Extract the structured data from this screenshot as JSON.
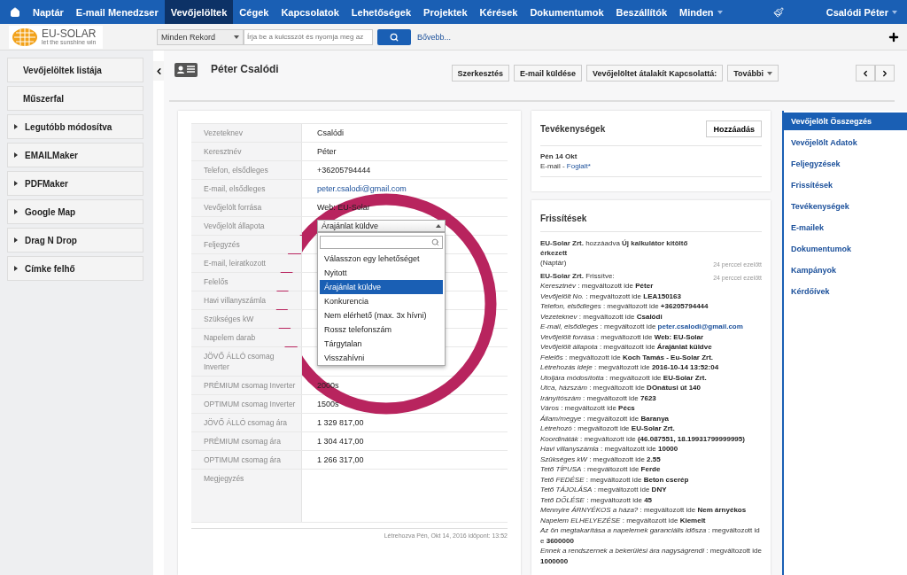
{
  "top_nav": {
    "items": [
      {
        "label": "Naptár",
        "selected": false
      },
      {
        "label": "E-mail Menedzser",
        "selected": false
      },
      {
        "label": "Vevőjelöltek",
        "selected": true
      },
      {
        "label": "Cégek",
        "selected": false
      },
      {
        "label": "Kapcsolatok",
        "selected": false
      },
      {
        "label": "Lehetőségek",
        "selected": false
      },
      {
        "label": "Projektek",
        "selected": false
      },
      {
        "label": "Kérések",
        "selected": false
      },
      {
        "label": "Dokumentumok",
        "selected": false
      },
      {
        "label": "Beszállítók",
        "selected": false
      },
      {
        "label": "Minden",
        "selected": false,
        "dropdown": true
      }
    ],
    "user": "Csalódi Péter"
  },
  "search_bar": {
    "logo": {
      "name": "EU-SOLAR",
      "tagline": "let the sunshine win"
    },
    "scope": "Minden Rekord",
    "placeholder": "Írja be a kulcsszót és nyomja meg az",
    "more_link": "Bővebb..."
  },
  "sidebar": {
    "items": [
      {
        "label": "Vevőjelöltek listája",
        "kind": "plain"
      },
      {
        "label": "Műszerfal",
        "kind": "plain"
      },
      {
        "label": "Legutóbb módosítva",
        "kind": "expandable"
      },
      {
        "label": "EMAILMaker",
        "kind": "expandable"
      },
      {
        "label": "PDFMaker",
        "kind": "expandable"
      },
      {
        "label": "Google Map",
        "kind": "expandable"
      },
      {
        "label": "Drag N Drop",
        "kind": "expandable"
      },
      {
        "label": "Címke felhő",
        "kind": "expandable"
      }
    ]
  },
  "record": {
    "title": "Péter Csalódi",
    "actions": [
      {
        "label": "Szerkesztés"
      },
      {
        "label": "E-mail küldése"
      },
      {
        "label": "Vevőjelöltet átalakít Kapcsolattá:"
      },
      {
        "label": "További",
        "dropdown": true
      }
    ]
  },
  "details": {
    "rows": [
      {
        "label": "Vezeteknev",
        "value": "Csalódi",
        "kind": "text"
      },
      {
        "label": "Keresztnév",
        "value": "Péter",
        "kind": "text"
      },
      {
        "label": "Telefon, elsődleges",
        "value": "+36205794444",
        "kind": "text"
      },
      {
        "label": "E-mail, elsődleges",
        "value": "peter.csalodi@gmail.com",
        "kind": "link"
      },
      {
        "label": "Vevőjelölt forrása",
        "value": "Web: EU-Solar",
        "kind": "text"
      },
      {
        "label": "Vevőjelölt állapota",
        "kind": "select"
      },
      {
        "label": "Feljegyzés",
        "kind": "text"
      },
      {
        "label": "E-mail, leiratkozott",
        "kind": "text"
      },
      {
        "label": "Felelős",
        "kind": "text"
      },
      {
        "label": "Havi villanyszámla",
        "kind": "text"
      },
      {
        "label": "Szükséges kW",
        "kind": "text"
      },
      {
        "label": "Napelem darab",
        "kind": "text"
      },
      {
        "label": "JÖVŐ ÁLLÓ csomag Inverter",
        "kind": "text"
      },
      {
        "label": "PRÉMIUM csomag Inverter",
        "value": "2000s",
        "kind": "text"
      },
      {
        "label": "OPTIMUM csomag Inverter",
        "value": "1500s",
        "kind": "text"
      },
      {
        "label": "JÖVŐ ÁLLÓ csomag ára",
        "value": "1 329 817,00",
        "kind": "text"
      },
      {
        "label": "PRÉMIUM csomag ára",
        "value": "1 304 417,00",
        "kind": "text"
      },
      {
        "label": "OPTIMUM csomag ára",
        "value": "1 266 317,00",
        "kind": "text"
      },
      {
        "label": "Megjegyzés",
        "kind": "note"
      }
    ],
    "status_select": {
      "value": "Árajánlat küldve",
      "options": [
        {
          "label": "Válasszon egy lehetőséget",
          "selected": false
        },
        {
          "label": "Nyitott",
          "selected": false
        },
        {
          "label": "Árajánlat küldve",
          "selected": true
        },
        {
          "label": "Konkurencia",
          "selected": false
        },
        {
          "label": "Nem elérhető (max. 3x hívni)",
          "selected": false
        },
        {
          "label": "Rossz telefonszám",
          "selected": false
        },
        {
          "label": "Tárgytalan",
          "selected": false
        },
        {
          "label": "Visszahívni",
          "selected": false
        }
      ]
    },
    "created": "Létrehozva Pén, Okt 14, 2016 időpont: 13:52"
  },
  "activities": {
    "title": "Tevékenységek",
    "add_button": "Hozzáadás",
    "items": [
      {
        "date": "Pén 14 Okt",
        "type": "E-mail -",
        "status": "Foglalt*"
      }
    ]
  },
  "updates": {
    "title": "Frissítések",
    "entries": [
      {
        "actor": "EU-Solar Zrt.",
        "action": "hozzáadva",
        "target": "Új kalkulátor kitöltő érkezett",
        "source": "(Naptár)",
        "time": "24 perccel ezelőtt"
      },
      {
        "actor": "EU-Solar Zrt.",
        "action": "Frissítve:",
        "time": "24 perccel ezelőtt",
        "changes": [
          {
            "field": "Keresztnév",
            "sep": ":",
            "verb": "megváltozott ide",
            "value": "Péter",
            "kind": "text"
          },
          {
            "field": "Vevőjelölt No.",
            "sep": ":",
            "verb": "megváltozott ide",
            "value": "LEA150163",
            "kind": "text"
          },
          {
            "field": "Telefon, elsődleges",
            "sep": ":",
            "verb": "megváltozott ide",
            "value": "+36205794444",
            "kind": "text"
          },
          {
            "field": "Vezeteknev",
            "sep": ":",
            "verb": "megváltozott ide",
            "value": "Csalódi",
            "kind": "text"
          },
          {
            "field": "E-mail, elsődleges",
            "sep": ":",
            "verb": "megváltozott ide",
            "value": "peter.csalodi@gmail.com",
            "kind": "link"
          },
          {
            "field": "Vevőjelölt forrása",
            "sep": ":",
            "verb": "megváltozott ide",
            "value": "Web: EU-Solar",
            "kind": "text"
          },
          {
            "field": "Vevőjelölt állapota",
            "sep": ":",
            "verb": "megváltozott ide",
            "value": "Árajánlat küldve",
            "kind": "text"
          },
          {
            "field": "Felelős",
            "sep": ":",
            "verb": "megváltozott ide",
            "value": "Koch Tamás - Eu-Solar Zrt.",
            "kind": "text"
          },
          {
            "field": "Létrehozás ideje",
            "sep": ":",
            "verb": "megváltozott ide",
            "value": "2016-10-14 13:52:04",
            "kind": "text"
          },
          {
            "field": "Utoljára módosította",
            "sep": ":",
            "verb": "megváltozott ide",
            "value": "EU-Solar Zrt.",
            "kind": "text"
          },
          {
            "field": "Utca, házszám",
            "sep": ":",
            "verb": "megváltozott ide",
            "value": "DOnátusi út 140",
            "kind": "text"
          },
          {
            "field": "Irányítószám",
            "sep": ":",
            "verb": "megváltozott ide",
            "value": "7623",
            "kind": "text"
          },
          {
            "field": "Város",
            "sep": ":",
            "verb": "megváltozott ide",
            "value": "Pécs",
            "kind": "text"
          },
          {
            "field": "Állam/megye",
            "sep": ":",
            "verb": "megváltozott ide",
            "value": "Baranya",
            "kind": "text"
          },
          {
            "field": "Létrehozó",
            "sep": ":",
            "verb": "megváltozott ide",
            "value": "EU-Solar Zrt.",
            "kind": "text"
          },
          {
            "field": "Koordináták",
            "sep": ":",
            "verb": "megváltozott ide",
            "value": "(46.087551, 18.19931799999995)",
            "kind": "text"
          },
          {
            "field": "Havi villanyszámla",
            "sep": ":",
            "verb": "megváltozott ide",
            "value": "10000",
            "kind": "text"
          },
          {
            "field": "Szükséges kW",
            "sep": ":",
            "verb": "megváltozott ide",
            "value": "2.55",
            "kind": "text"
          },
          {
            "field": "Tető TÍPUSA",
            "sep": ":",
            "verb": "megváltozott ide",
            "value": "Ferde",
            "kind": "text"
          },
          {
            "field": "Tető FEDÉSE",
            "sep": ":",
            "verb": "megváltozott ide",
            "value": "Beton cserép",
            "kind": "text"
          },
          {
            "field": "Tető TÁJOLÁSA",
            "sep": ":",
            "verb": "megváltozott ide",
            "value": "DNY",
            "kind": "text"
          },
          {
            "field": "Tető DŐLÉSE",
            "sep": ":",
            "verb": "megváltozott ide",
            "value": "45",
            "kind": "text"
          },
          {
            "field": "Mennyire ÁRNYÉKOS a háza?",
            "sep": ":",
            "verb": "megváltozott ide",
            "value": "Nem árnyékos",
            "kind": "text"
          },
          {
            "field": "Napelem ELHELYEZÉSE",
            "sep": ":",
            "verb": "megváltozott ide",
            "value": "Kiemelt",
            "kind": "text"
          },
          {
            "field": "Az ön megtakarítása a napelemek garanciális idősza",
            "sep": ":",
            "verb": "megváltozott ide",
            "value": "3600000",
            "kind": "text"
          },
          {
            "field": "Ennek a rendszernek a bekerülési ára nagyságrendi",
            "sep": ":",
            "verb": "megváltozott ide",
            "value": "1000000",
            "kind": "text"
          }
        ]
      }
    ]
  },
  "section_nav": {
    "items": [
      {
        "label": "Vevőjelölt Összegzés",
        "selected": true
      },
      {
        "label": "Vevőjelölt Adatok",
        "selected": false
      },
      {
        "label": "Feljegyzések",
        "selected": false
      },
      {
        "label": "Frissítések",
        "selected": false
      },
      {
        "label": "Tevékenységek",
        "selected": false
      },
      {
        "label": "E-mailek",
        "selected": false
      },
      {
        "label": "Dokumentumok",
        "selected": false
      },
      {
        "label": "Kampányok",
        "selected": false
      },
      {
        "label": "Kérdőívek",
        "selected": false
      }
    ]
  }
}
